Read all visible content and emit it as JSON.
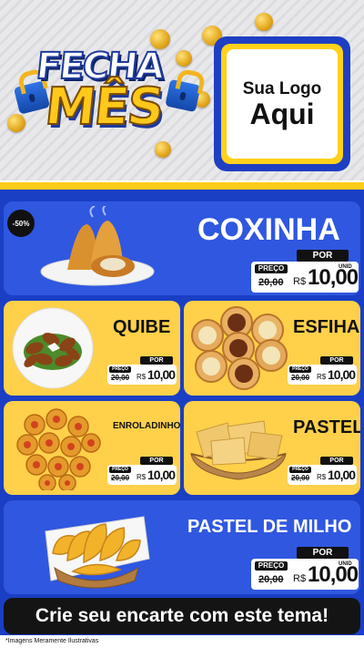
{
  "header": {
    "title_line1": "FECHA",
    "title_line2": "MÊS",
    "logo_line1": "Sua Logo",
    "logo_line2": "Aqui"
  },
  "badge": "-50%",
  "price_labels": {
    "por": "POR",
    "preco": "PREÇO",
    "currency": "R$",
    "unit": "UNID"
  },
  "products": [
    {
      "name": "COXINHA",
      "old_price": "20,00",
      "price": "10,00"
    },
    {
      "name": "QUIBE",
      "old_price": "20,00",
      "price": "10,00"
    },
    {
      "name": "ESFIHA",
      "old_price": "20,00",
      "price": "10,00"
    },
    {
      "name": "ENROLADINHO",
      "old_price": "20,00",
      "price": "10,00"
    },
    {
      "name": "PASTEL",
      "old_price": "20,00",
      "price": "10,00"
    },
    {
      "name": "PASTEL DE MILHO",
      "old_price": "20,00",
      "price": "10,00"
    }
  ],
  "footer": {
    "cta": "Crie seu encarte com este tema!",
    "disclaimer": "*Imagens Meramente Ilustrativas"
  },
  "colors": {
    "blue": "#2f57e0",
    "yellow": "#ffd04a",
    "dark": "#141414"
  }
}
